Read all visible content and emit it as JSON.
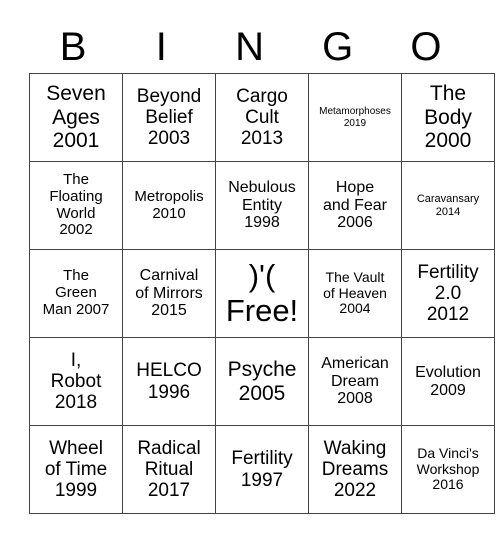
{
  "header": [
    "B",
    "I",
    "N",
    "G",
    "O"
  ],
  "grid": [
    [
      "Seven Ages 2001",
      "Beyond Belief 2003",
      "Cargo Cult 2013",
      "Metamorphoses 2019",
      "The Body 2000"
    ],
    [
      "The Floating World 2002",
      "Metropolis 2010",
      "Nebulous Entity 1998",
      "Hope and Fear 2006",
      "Caravansary 2014"
    ],
    [
      "The Green Man 2007",
      "Carnival of Mirrors 2015",
      ")'( Free!",
      "The Vault of Heaven 2004",
      "Fertility 2.0 2012"
    ],
    [
      "I, Robot 2018",
      "HELCO 1996",
      "Psyche 2005",
      "American Dream 2008",
      "Evolution 2009"
    ],
    [
      "Wheel of Time 1999",
      "Radical Ritual 2017",
      "Fertility 1997",
      "Waking Dreams 2022",
      "Da Vinci's Workshop 2016"
    ]
  ],
  "cells": {
    "r0": [
      [
        "Seven",
        "Ages",
        "2001"
      ],
      [
        "Beyond",
        "Belief",
        "2003"
      ],
      [
        "Cargo",
        "Cult",
        "2013"
      ],
      [
        "Metamorphoses",
        "2019"
      ],
      [
        "The",
        "Body",
        "2000"
      ]
    ],
    "r1": [
      [
        "The",
        "Floating",
        "World",
        "2002"
      ],
      [
        "Metropolis",
        "2010"
      ],
      [
        "Nebulous",
        "Entity",
        "1998"
      ],
      [
        "Hope",
        "and Fear",
        "2006"
      ],
      [
        "Caravansary",
        "2014"
      ]
    ],
    "r2": [
      [
        "The",
        "Green",
        "Man 2007"
      ],
      [
        "Carnival",
        "of Mirrors",
        "2015"
      ],
      [
        ")'(",
        "Free!"
      ],
      [
        "The Vault",
        "of Heaven",
        "2004"
      ],
      [
        "Fertility",
        "2.0",
        "2012"
      ]
    ],
    "r3": [
      [
        "I,",
        "Robot",
        "2018"
      ],
      [
        "HELCO",
        "1996"
      ],
      [
        "Psyche",
        "2005"
      ],
      [
        "American",
        "Dream",
        "2008"
      ],
      [
        "Evolution",
        "2009"
      ]
    ],
    "r4": [
      [
        "Wheel",
        "of Time",
        "1999"
      ],
      [
        "Radical",
        "Ritual",
        "2017"
      ],
      [
        "Fertility",
        "1997"
      ],
      [
        "Waking",
        "Dreams",
        "2022"
      ],
      [
        "Da Vinci's",
        "Workshop",
        "2016"
      ]
    ]
  },
  "free_space": {
    "symbol": ")'(",
    "label": "Free!"
  }
}
